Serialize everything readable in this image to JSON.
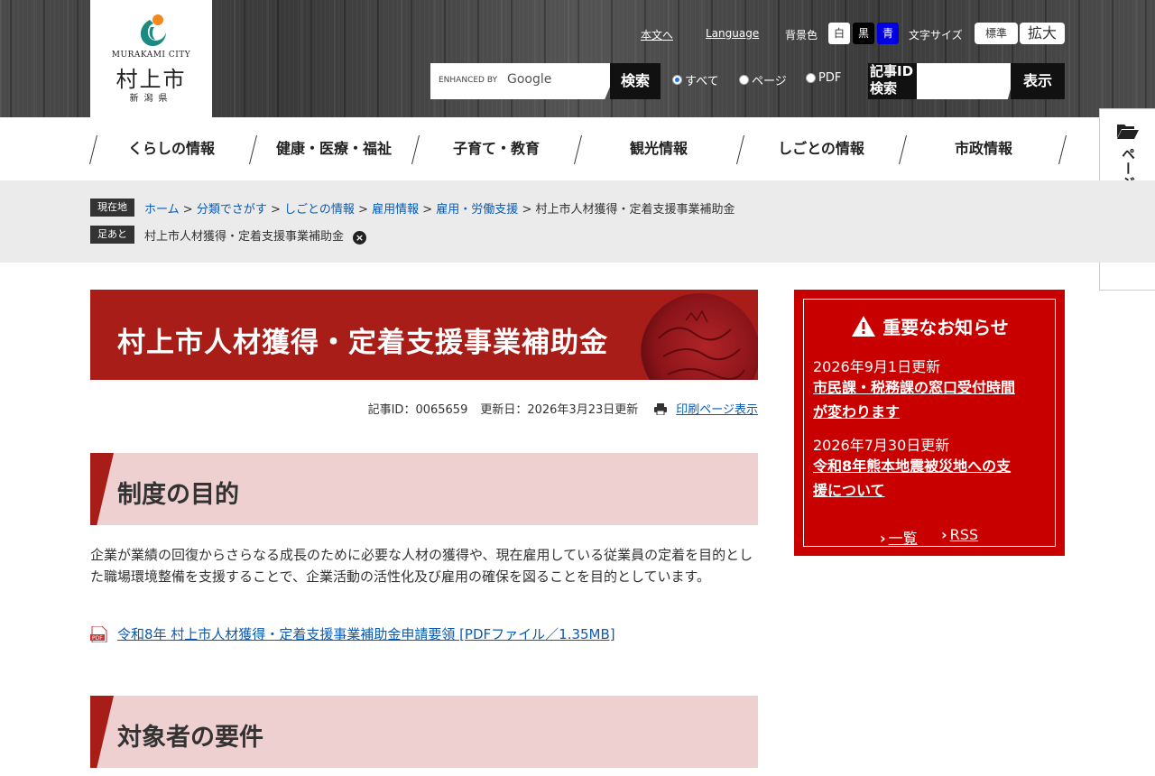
{
  "logo": {
    "city_en": "MURAKAMI CITY",
    "city_ja": "村上市",
    "pref": "新潟県"
  },
  "header": {
    "skip_link": "本文へ",
    "language": "Language",
    "bg_label": "背景色",
    "bg_white": "白",
    "bg_black": "黒",
    "bg_blue": "青",
    "font_label": "文字サイズ",
    "font_standard": "標準",
    "font_large": "拡大",
    "search_enhanced": "ENHANCED BY",
    "search_google": "Google",
    "search_button": "検索",
    "radio_all": "すべて",
    "radio_page": "ページ",
    "radio_pdf": "PDF",
    "id_search_label_1": "記事ID",
    "id_search_label_2": "検索",
    "id_search_button": "表示"
  },
  "nav": [
    "くらしの情報",
    "健康・医療・福祉",
    "子育て・教育",
    "観光情報",
    "しごとの情報",
    "市政情報"
  ],
  "side_tab": "ページを一時保存",
  "breadcrumb": {
    "current_label": "現在地",
    "items": [
      "ホーム",
      "分類でさがす",
      "しごとの情報",
      "雇用情報",
      "雇用・労働支援"
    ],
    "sep": ">",
    "current": "村上市人材獲得・定着支援事業補助金",
    "footprint_label": "足あと",
    "footprint_item": "村上市人材獲得・定着支援事業補助金",
    "close": "×"
  },
  "article": {
    "title": "村上市人材獲得・定着支援事業補助金",
    "id_text": "記事ID：0065659",
    "updated": "更新日：2026年3月23日更新",
    "print": "印刷ページ表示",
    "section1": "制度の目的",
    "body": "企業が業績の回復からさらなる成長のために必要な人材の獲得や、現在雇用している従業員の定着を目的とした職場環境整備を支援することで、企業活動の活性化及び雇用の確保を図ることを目的としています。",
    "pdf_link": "令和8年 村上市人材獲得・定着支援事業補助金申請要領 [PDFファイル／1.35MB]",
    "pdf_icon": "PDF",
    "section2": "対象者の要件"
  },
  "notice": {
    "title": "重要なお知らせ",
    "items": [
      {
        "date": "2026年9月1日更新",
        "line1": "市民課・税務課の窓口受付時間",
        "line2": "が変わります"
      },
      {
        "date": "2026年7月30日更新",
        "line1": "令和8年熊本地震被災地への支",
        "line2": "援について"
      }
    ],
    "list": "一覧",
    "rss": "RSS"
  },
  "colors": {
    "accent": "#a91d19",
    "notice": "#c90000",
    "link": "#0a5bb5"
  }
}
